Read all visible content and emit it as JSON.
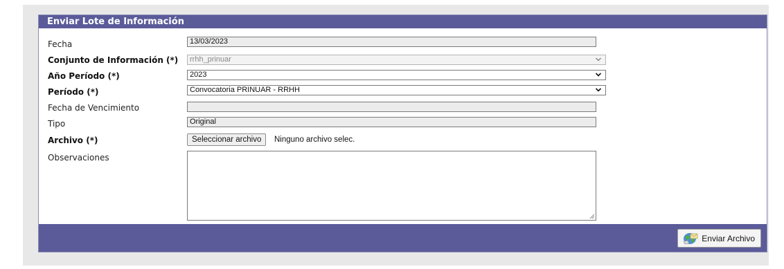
{
  "panel": {
    "title": "Enviar Lote de Información"
  },
  "fields": {
    "fecha": {
      "label": "Fecha",
      "value": "13/03/2023"
    },
    "conjunto": {
      "label": "Conjunto de Información (*)",
      "value": "rrhh_prinuar"
    },
    "anio": {
      "label": "Año Período (*)",
      "value": "2023"
    },
    "periodo": {
      "label": "Período (*)",
      "value": "Convocatoria PRINUAR - RRHH"
    },
    "vencimiento": {
      "label": "Fecha de Vencimiento",
      "value": ""
    },
    "tipo": {
      "label": "Tipo",
      "value": "Original"
    },
    "archivo": {
      "label": "Archivo (*)",
      "button": "Seleccionar archivo",
      "status": "Ninguno archivo selec."
    },
    "observaciones": {
      "label": "Observaciones",
      "value": ""
    }
  },
  "footer": {
    "send_label": "Enviar Archivo"
  },
  "icons": {
    "send": "send-archive-icon",
    "chevron": "chevron-down-icon",
    "resize": "resize-grip-icon"
  },
  "colors": {
    "header_bg": "#5b5b9a",
    "footer_bg": "#5b5b9a",
    "outer_bg": "#e8e8e8"
  }
}
